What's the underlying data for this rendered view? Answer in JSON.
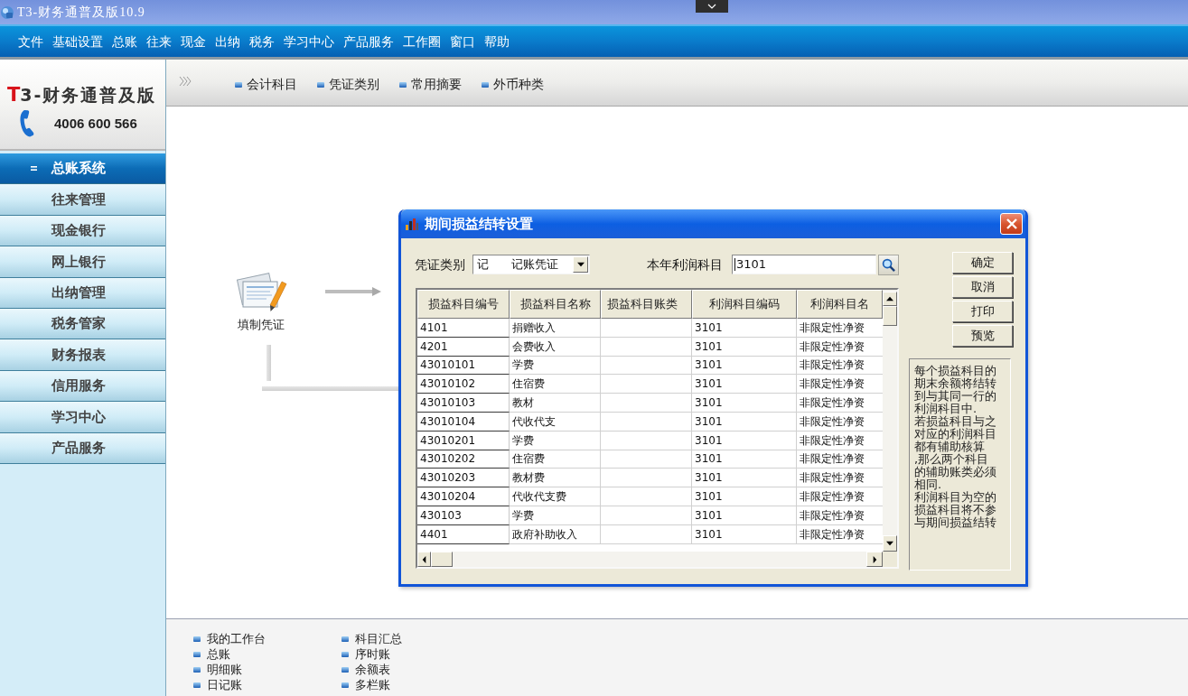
{
  "window": {
    "title": "T3-财务通普及版10.9"
  },
  "menu_bar": {
    "items": [
      "文件",
      "基础设置",
      "总账",
      "往来",
      "现金",
      "出纳",
      "税务",
      "学习中心",
      "产品服务",
      "工作圈",
      "窗口",
      "帮助"
    ]
  },
  "sidebar": {
    "logo": {
      "initial": "T",
      "name": "3-财务通普及版"
    },
    "phone": "4006 600 566",
    "items": [
      {
        "label": "总账系统",
        "selected": true
      },
      {
        "label": "往来管理",
        "selected": false
      },
      {
        "label": "现金银行",
        "selected": false
      },
      {
        "label": "网上银行",
        "selected": false
      },
      {
        "label": "出纳管理",
        "selected": false
      },
      {
        "label": "税务管家",
        "selected": false
      },
      {
        "label": "财务报表",
        "selected": false
      },
      {
        "label": "信用服务",
        "selected": false
      },
      {
        "label": "学习中心",
        "selected": false
      },
      {
        "label": "产品服务",
        "selected": false
      }
    ]
  },
  "toolbar": {
    "items": [
      "会计科目",
      "凭证类别",
      "常用摘要",
      "外币种类"
    ]
  },
  "workflow": {
    "nodes": [
      {
        "label": "填制凭证"
      }
    ]
  },
  "dialog": {
    "title": "期间损益结转设置",
    "voucher_type": {
      "label": "凭证类别",
      "code": "记",
      "name": "记账凭证"
    },
    "profit_account": {
      "label": "本年利润科目",
      "value": "3101"
    },
    "table": {
      "columns": [
        "损益科目编号",
        "损益科目名称",
        "损益科目账类",
        "利润科目编码",
        "利润科目名"
      ],
      "rows": [
        {
          "code": "4101",
          "name": "捐赠收入",
          "profit_code": "3101",
          "profit_name": "非限定性净资"
        },
        {
          "code": "4201",
          "name": "会费收入",
          "profit_code": "3101",
          "profit_name": "非限定性净资"
        },
        {
          "code": "43010101",
          "name": "学费",
          "profit_code": "3101",
          "profit_name": "非限定性净资"
        },
        {
          "code": "43010102",
          "name": "住宿费",
          "profit_code": "3101",
          "profit_name": "非限定性净资"
        },
        {
          "code": "43010103",
          "name": "教材",
          "profit_code": "3101",
          "profit_name": "非限定性净资"
        },
        {
          "code": "43010104",
          "name": "代收代支",
          "profit_code": "3101",
          "profit_name": "非限定性净资"
        },
        {
          "code": "43010201",
          "name": "学费",
          "profit_code": "3101",
          "profit_name": "非限定性净资"
        },
        {
          "code": "43010202",
          "name": "住宿费",
          "profit_code": "3101",
          "profit_name": "非限定性净资"
        },
        {
          "code": "43010203",
          "name": "教材费",
          "profit_code": "3101",
          "profit_name": "非限定性净资"
        },
        {
          "code": "43010204",
          "name": "代收代支费",
          "profit_code": "3101",
          "profit_name": "非限定性净资"
        },
        {
          "code": "430103",
          "name": "学费",
          "profit_code": "3101",
          "profit_name": "非限定性净资"
        },
        {
          "code": "4401",
          "name": "政府补助收入",
          "profit_code": "3101",
          "profit_name": "非限定性净资"
        }
      ]
    },
    "buttons": [
      "确定",
      "取消",
      "打印",
      "预览"
    ],
    "note_lines": [
      "每个损益科目的",
      "期末余额将结转",
      "到与其同一行的",
      "利润科目中.",
      "若损益科目与之",
      "对应的利润科目",
      "都有辅助核算",
      ",那么两个科目",
      "的辅助账类必须",
      "相同.",
      "利润科目为空的",
      "损益科目将不参",
      "与期间损益结转"
    ]
  },
  "bottom_links": {
    "columns": [
      [
        "我的工作台",
        "总账",
        "明细账",
        "日记账"
      ],
      [
        "科目汇总",
        "序时账",
        "余额表",
        "多栏账"
      ]
    ]
  }
}
